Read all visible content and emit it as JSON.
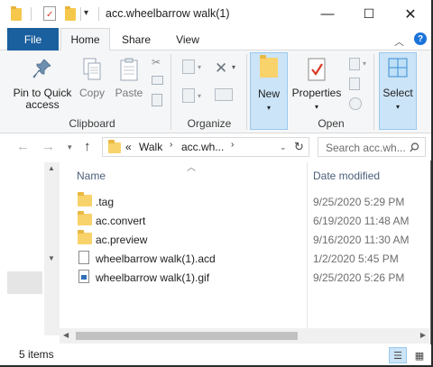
{
  "window": {
    "title": "acc.wheelbarrow walk(1)"
  },
  "title_controls": {
    "minimize": "—",
    "maximize": "☐",
    "close": "✕"
  },
  "tabs": {
    "file": "File",
    "home": "Home",
    "share": "Share",
    "view": "View"
  },
  "ribbon": {
    "pin_label_1": "Pin to Quick",
    "pin_label_2": "access",
    "copy": "Copy",
    "paste": "Paste",
    "clipboard_group": "Clipboard",
    "organize_group": "Organize",
    "new": "New",
    "properties": "Properties",
    "open_group": "Open",
    "select": "Select"
  },
  "address": {
    "prefix": "«",
    "crumb1": "Walk",
    "crumb2": "acc.wh...",
    "search_placeholder": "Search acc.wh..."
  },
  "columns": {
    "name": "Name",
    "date": "Date modified"
  },
  "files": [
    {
      "name": ".tag",
      "date": "9/25/2020 5:29 PM",
      "icon": "folder-icon"
    },
    {
      "name": "ac.convert",
      "date": "6/19/2020 11:48 AM",
      "icon": "folder-icon"
    },
    {
      "name": "ac.preview",
      "date": "9/16/2020 11:30 AM",
      "icon": "folder-icon"
    },
    {
      "name": "wheelbarrow walk(1).acd",
      "date": "1/2/2020 5:45 PM",
      "icon": "document-icon"
    },
    {
      "name": "wheelbarrow walk(1).gif",
      "date": "9/25/2020 5:26 PM",
      "icon": "image-file-icon"
    }
  ],
  "status": {
    "item_count": "5 items"
  },
  "colors": {
    "file_tab": "#1a5f9e",
    "folder": "#f8d26a",
    "header_text": "#4c607a",
    "selection": "#cce4f7"
  }
}
